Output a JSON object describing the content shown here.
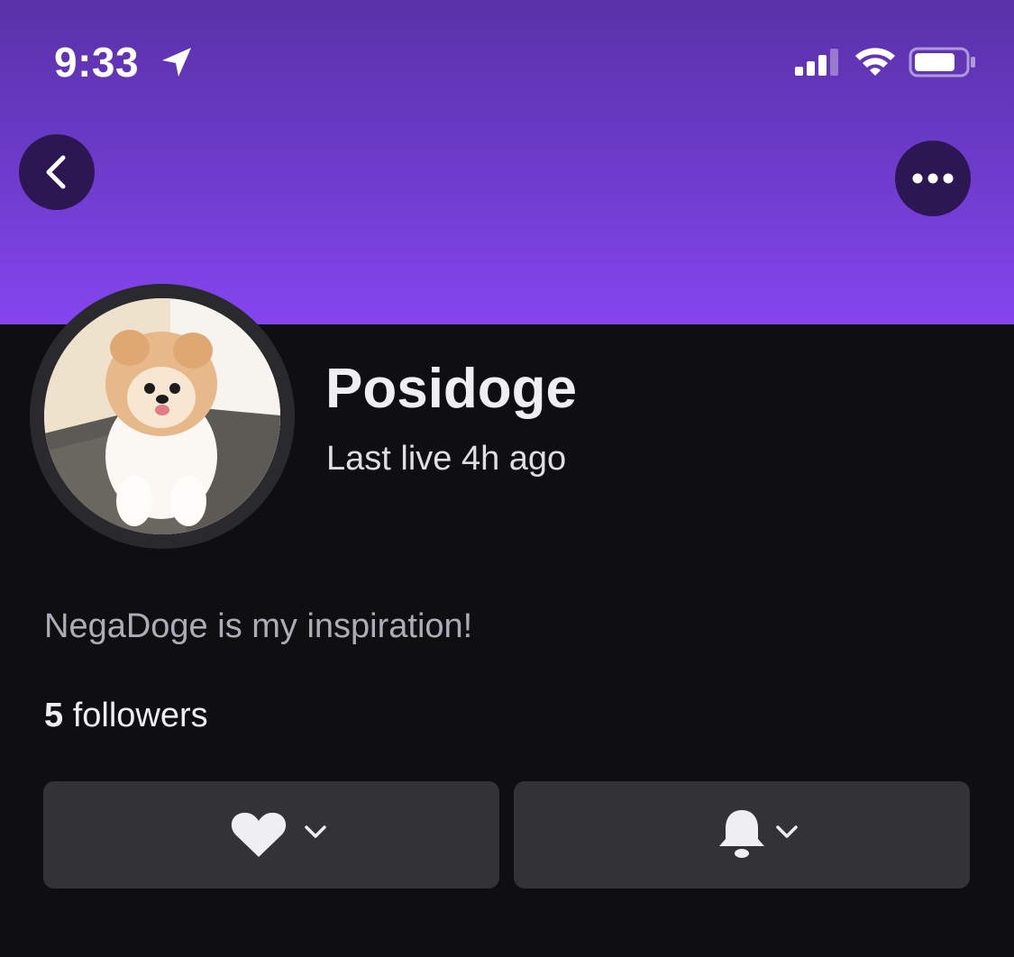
{
  "status_bar": {
    "time": "9:33",
    "icons": [
      "location-arrow-icon",
      "cellular-signal-icon",
      "wifi-icon",
      "battery-icon"
    ]
  },
  "header": {
    "gradient_colors": [
      "#5a31a8",
      "#8445ef"
    ],
    "back_button_icon": "chevron-left-icon",
    "more_button_icon": "more-dots-icon"
  },
  "profile": {
    "channel_name": "Posidoge",
    "last_live": "Last live 4h ago",
    "bio": "NegaDoge is my inspiration!",
    "followers_count": "5",
    "followers_label": " followers"
  },
  "actions": {
    "follow": {
      "icon": "heart-icon",
      "dropdown_icon": "chevron-down-icon"
    },
    "notifications": {
      "icon": "bell-icon",
      "dropdown_icon": "chevron-down-icon"
    }
  },
  "colors": {
    "background": "#0f0f12",
    "button_bg": "#333336",
    "nav_button_bg": "#2c1753",
    "text_primary": "#efeff1",
    "text_secondary": "#adadb8"
  }
}
